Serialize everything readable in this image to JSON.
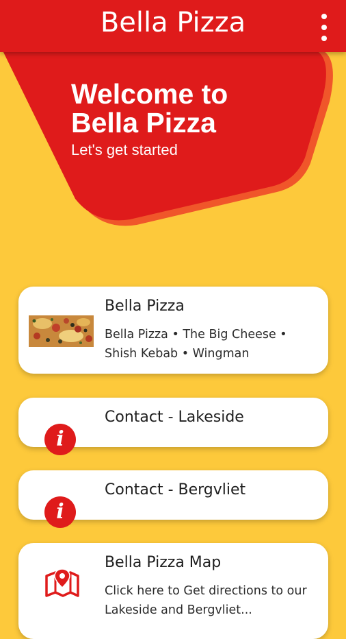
{
  "appbar": {
    "title": "Bella Pizza",
    "menu_icon": "more-vert-icon"
  },
  "hero": {
    "title_line1": "Welcome to",
    "title_line2": "Bella Pizza",
    "subtitle": "Let's get started"
  },
  "cards": [
    {
      "title": "Bella Pizza",
      "description": "Bella Pizza • The Big Cheese • Shish Kebab • Wingman",
      "icon": "pizza-image"
    },
    {
      "title": "Contact - Lakeside",
      "icon": "info-icon",
      "icon_glyph": "i"
    },
    {
      "title": "Contact - Bergvliet",
      "icon": "info-icon",
      "icon_glyph": "i"
    },
    {
      "title": "Bella Pizza Map",
      "description": "Click here to Get directions to our Lakeside and Bergvliet...",
      "icon": "map-pin-icon"
    }
  ],
  "colors": {
    "brand_red": "#df1b1b",
    "background_yellow": "#fdc93b",
    "accent_orange": "#f0562a"
  }
}
